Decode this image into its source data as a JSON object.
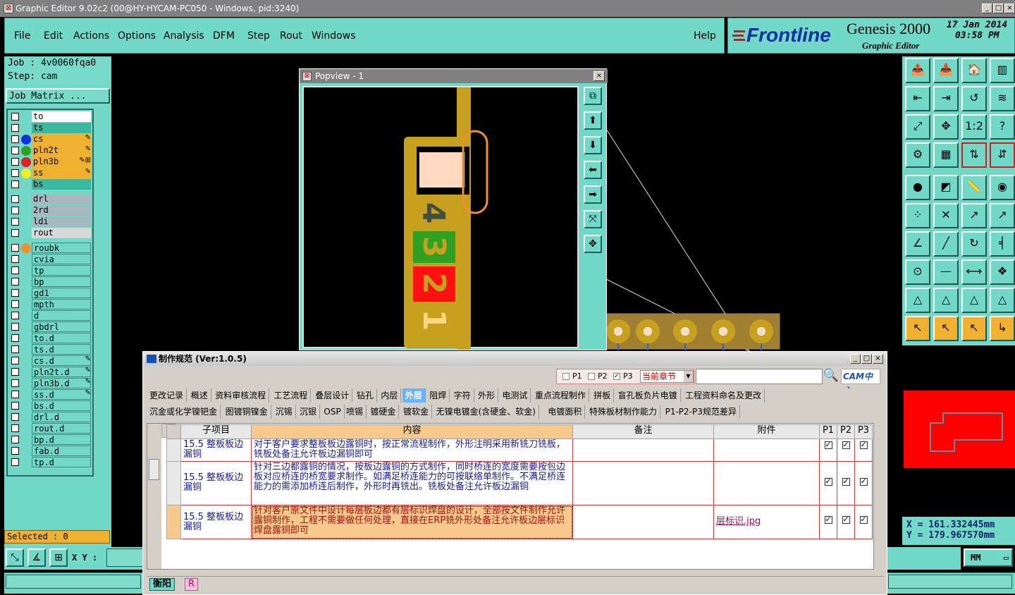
{
  "window": {
    "title": "Graphic Editor 9.02c2 (00@HY-HYCAM-PC050 - Windows, pid:3240)"
  },
  "menu": {
    "items": [
      "File",
      "Edit",
      "Actions",
      "Options",
      "Analysis",
      "DFM",
      "Step",
      "Rout",
      "Windows"
    ],
    "help": "Help"
  },
  "logo": {
    "brand": "Frontline",
    "product": "Genesis 2000",
    "sub": "Graphic Editor",
    "date": "17 Jan 2014",
    "time": "03:58 PM"
  },
  "job": {
    "job": "Job : 4v0060fqa0",
    "step": "Step: cam",
    "matrix": "Job Matrix ..."
  },
  "layers": [
    {
      "name": "to",
      "bg": "#ffffff",
      "dot": "",
      "edit": ""
    },
    {
      "name": "ts",
      "bg": "#3cb89e",
      "dot": "",
      "edit": ""
    },
    {
      "name": "cs",
      "bg": "#f0b030",
      "dot": "#1030e0",
      "edit": "✎"
    },
    {
      "name": "pln2t",
      "bg": "#f0b030",
      "dot": "#30a020",
      "edit": "✎"
    },
    {
      "name": "pln3b",
      "bg": "#f0b030",
      "dot": "#e02020",
      "edit": "✎⊞"
    },
    {
      "name": "ss",
      "bg": "#f0b030",
      "dot": "#f0f020",
      "edit": "✎"
    },
    {
      "name": "bs",
      "bg": "#3cb89e",
      "dot": "",
      "edit": ""
    },
    {
      "name": "drl",
      "bg": "#a8b8c0",
      "dot": "",
      "edit": ""
    },
    {
      "name": "2rd",
      "bg": "#a8b8c0",
      "dot": "",
      "edit": ""
    },
    {
      "name": "ldi",
      "bg": "#a8b8c0",
      "dot": "",
      "edit": ""
    },
    {
      "name": "rout",
      "bg": "#d8d8d8",
      "dot": "",
      "edit": ""
    },
    {
      "name": "roubk",
      "bg": "#72d8c8",
      "dot": "#f09030",
      "edit": ""
    },
    {
      "name": "cvia",
      "bg": "#72d8c8",
      "dot": "",
      "edit": ""
    },
    {
      "name": "tp",
      "bg": "#72d8c8",
      "dot": "",
      "edit": ""
    },
    {
      "name": "bp",
      "bg": "#72d8c8",
      "dot": "",
      "edit": ""
    },
    {
      "name": "gd1",
      "bg": "#72d8c8",
      "dot": "",
      "edit": ""
    },
    {
      "name": "mpth",
      "bg": "#72d8c8",
      "dot": "",
      "edit": ""
    },
    {
      "name": "d",
      "bg": "#72d8c8",
      "dot": "",
      "edit": ""
    },
    {
      "name": "gbdrl",
      "bg": "#72d8c8",
      "dot": "",
      "edit": ""
    },
    {
      "name": "to.d",
      "bg": "#72d8c8",
      "dot": "",
      "edit": ""
    },
    {
      "name": "ts.d",
      "bg": "#72d8c8",
      "dot": "",
      "edit": ""
    },
    {
      "name": "cs.d",
      "bg": "#72d8c8",
      "dot": "",
      "edit": "✎"
    },
    {
      "name": "pln2t.d",
      "bg": "#72d8c8",
      "dot": "",
      "edit": "✎"
    },
    {
      "name": "pln3b.d",
      "bg": "#72d8c8",
      "dot": "",
      "edit": "✎"
    },
    {
      "name": "ss.d",
      "bg": "#72d8c8",
      "dot": "",
      "edit": "✎"
    },
    {
      "name": "bs.d",
      "bg": "#72d8c8",
      "dot": "",
      "edit": ""
    },
    {
      "name": "drl.d",
      "bg": "#72d8c8",
      "dot": "",
      "edit": ""
    },
    {
      "name": "rout.d",
      "bg": "#72d8c8",
      "dot": "",
      "edit": ""
    },
    {
      "name": "bp.d",
      "bg": "#72d8c8",
      "dot": "",
      "edit": ""
    },
    {
      "name": "fab.d",
      "bg": "#72d8c8",
      "dot": "",
      "edit": ""
    },
    {
      "name": "tp.d",
      "bg": "#72d8c8",
      "dot": "",
      "edit": ""
    }
  ],
  "selected": "Selected : 0",
  "xy_label": "X Y :",
  "units": "MM",
  "coords": {
    "x": "X = 161.332445mm",
    "y": "Y = 179.967570mm"
  },
  "popview": {
    "title": "Popview - 1",
    "digits": [
      "4",
      "3",
      "2",
      "1"
    ]
  },
  "dialog": {
    "title": "制作规范 (Ver:1.0.5)",
    "filters": {
      "p1": "P1",
      "p2": "P2",
      "p3": "P3",
      "scope": "当前章节",
      "logo": "CAM中心"
    },
    "tabs1": [
      "更改记录",
      "概述",
      "资料审核流程",
      "工艺流程",
      "叠层设计",
      "钻孔",
      "内层",
      "外层",
      "阻焊",
      "字符",
      "外形",
      "电测试",
      "重点流程制作",
      "拼板",
      "盲孔板负片电镀",
      "工程资料命名及更改"
    ],
    "active_tab": "外层",
    "tabs2": [
      "沉金或化学镍钯金",
      "图镀铜镍金",
      "沉锡",
      "沉银",
      "OSP",
      "喷锡",
      "镀硬金",
      "镀软金",
      "无镍电镀金(含硬金、软金)",
      "电镀面积",
      "特殊板材制作能力",
      "P1-P2-P3规范差异"
    ],
    "columns": [
      "子项目",
      "内容",
      "备注",
      "附件",
      "P1",
      "P2",
      "P3"
    ],
    "rows": [
      {
        "item": "15.5 整板板边漏铜",
        "content": "对于客户要求整板板边露铜时，按正常流程制作，外形注明采用新铣刀铣板，铣板处备注允许板边漏铜即可",
        "note": "",
        "attach": ""
      },
      {
        "item": "15.5 整板板边漏铜",
        "content": "针对三边都露铜的情况，按板边露铜的方式制作，同时桥连的宽度需要按包边板对应桥连的桥宽要求制作。如满足桥连能力的可按联络单制作。不满足桥连能力的需添加桥连后制作，外形时再铣出。铣板处备注允许板边漏铜",
        "note": "",
        "attach": ""
      },
      {
        "item": "15.5 整板板边漏铜",
        "content": "针对客户原文件中设计每层板边都有层标识焊盘的设计，全部按文件制作允许露铜制作，工程不需要做任何处理，直接在ERP铣外形处备注允许板边层标识焊盘露铜即可",
        "note": "",
        "attach": "层标识.jpg"
      }
    ],
    "status": [
      "衡阳",
      "R"
    ]
  },
  "colors": {
    "teal": "#72d8c8",
    "board": "#c8a020",
    "red": "#ff0000"
  }
}
